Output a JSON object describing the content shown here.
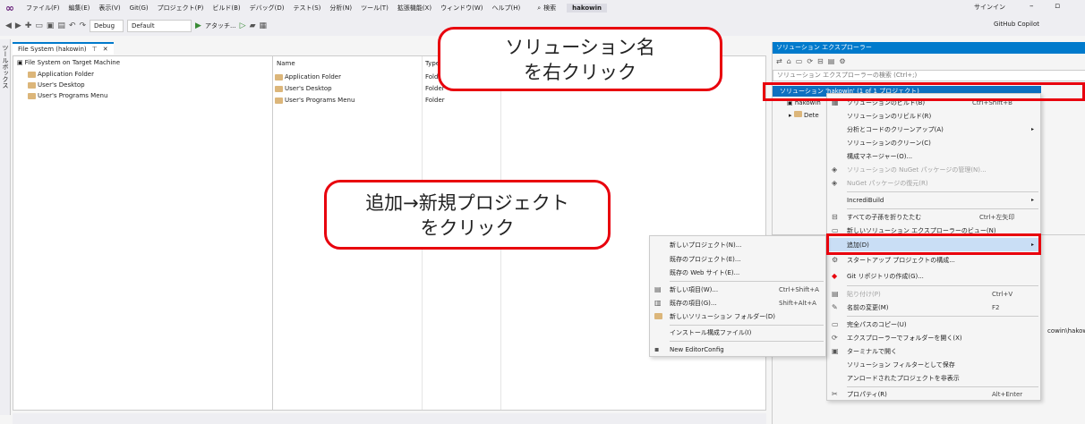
{
  "menubar": {
    "items": [
      "ファイル(F)",
      "編集(E)",
      "表示(V)",
      "Git(G)",
      "プロジェクト(P)",
      "ビルド(B)",
      "デバッグ(D)",
      "テスト(S)",
      "分析(N)",
      "ツール(T)",
      "拡張機能(X)",
      "ウィンドウ(W)",
      "ヘルプ(H)"
    ],
    "search": "検索",
    "solution_name": "hakowin",
    "signin": "サインイン"
  },
  "toolbar": {
    "config": "Debug",
    "platform": "Default",
    "attach": "アタッチ...",
    "copilot": "GitHub Copilot"
  },
  "toolbox_label": "ツールボックス",
  "doc_tab": {
    "title": "File System (hakowin)"
  },
  "fs_tree": {
    "root": "File System on Target Machine",
    "children": [
      "Application Folder",
      "User's Desktop",
      "User's Programs Menu"
    ]
  },
  "fs_list": {
    "headers": [
      "Name",
      "Type"
    ],
    "rows": [
      {
        "name": "Application Folder",
        "type": "Folder"
      },
      {
        "name": "User's Desktop",
        "type": "Folder"
      },
      {
        "name": "User's Programs Menu",
        "type": "Folder"
      }
    ]
  },
  "solution_explorer": {
    "title": "ソリューション エクスプローラー",
    "search_placeholder": "ソリューション エクスプローラーの検索 (Ctrl+;)",
    "selected": "ソリューション 'hakowin' (1 of 1 プロジェクト)",
    "project": "hakowin",
    "folder": "Dete",
    "side_text": "cowin\\hakow"
  },
  "context_menu": {
    "items": [
      {
        "label": "ソリューションのビルド(B)",
        "shortcut": "Ctrl+Shift+B"
      },
      {
        "label": "ソリューションのリビルド(R)"
      },
      {
        "label": "分析とコードのクリーンアップ(A)",
        "arrow": "▸"
      },
      {
        "label": "ソリューションのクリーン(C)"
      },
      {
        "label": "構成マネージャー(O)..."
      },
      {
        "label": "ソリューションの NuGet パッケージの管理(N)...",
        "disabled": true
      },
      {
        "label": "NuGet パッケージの復元(R)",
        "disabled": true
      },
      {
        "label": "IncrediBuild",
        "arrow": "▸"
      },
      {
        "label": "すべての子孫を折りたたむ",
        "shortcut": "Ctrl+左矢印"
      },
      {
        "label": "新しいソリューション エクスプローラーのビュー(N)"
      },
      {
        "label": "追加(D)",
        "arrow": "▸"
      },
      {
        "label": "スタートアップ プロジェクトの構成..."
      },
      {
        "label": "Git リポジトリの作成(G)..."
      },
      {
        "label": "貼り付け(P)",
        "shortcut": "Ctrl+V",
        "disabled": true
      },
      {
        "label": "名前の変更(M)",
        "shortcut": "F2"
      },
      {
        "label": "完全パスのコピー(U)"
      },
      {
        "label": "エクスプローラーでフォルダーを開く(X)"
      },
      {
        "label": "ターミナルで開く"
      },
      {
        "label": "ソリューション フィルターとして保存"
      },
      {
        "label": "アンロードされたプロジェクトを非表示"
      },
      {
        "label": "プロパティ(R)",
        "shortcut": "Alt+Enter"
      }
    ]
  },
  "submenu": {
    "items": [
      {
        "label": "新しいプロジェクト(N)..."
      },
      {
        "label": "既存のプロジェクト(E)..."
      },
      {
        "label": "既存の Web サイト(E)..."
      },
      {
        "label": "新しい項目(W)...",
        "shortcut": "Ctrl+Shift+A"
      },
      {
        "label": "既存の項目(G)...",
        "shortcut": "Shift+Alt+A"
      },
      {
        "label": "新しいソリューション フォルダー(D)"
      },
      {
        "label": "インストール構成ファイル(I)"
      },
      {
        "label": "New EditorConfig"
      }
    ]
  },
  "callouts": {
    "top": [
      "ソリューション名",
      "を右クリック"
    ],
    "middle": [
      "追加→新規プロジェクト",
      "をクリック"
    ]
  },
  "colors": {
    "accent": "#007acc",
    "highlight": "#e8000d"
  }
}
